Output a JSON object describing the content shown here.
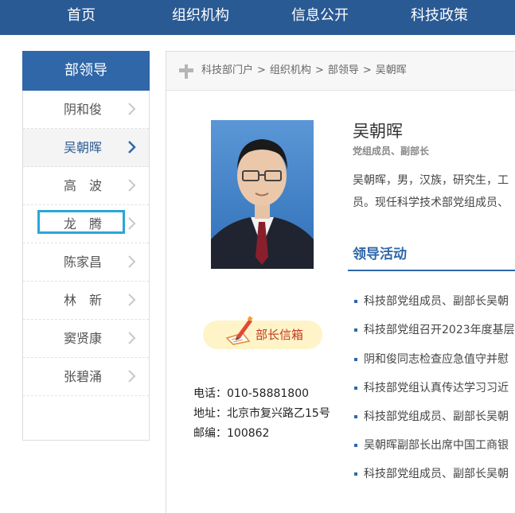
{
  "nav": {
    "items": [
      "首页",
      "组织机构",
      "信息公开",
      "科技政策"
    ]
  },
  "sidebar": {
    "title": "部领导",
    "items": [
      {
        "label": "阴和俊"
      },
      {
        "label": "吴朝晖"
      },
      {
        "label": "高　波"
      },
      {
        "label": "龙　腾"
      },
      {
        "label": "陈家昌"
      },
      {
        "label": "林　新"
      },
      {
        "label": "窦贤康"
      },
      {
        "label": "张碧涌"
      }
    ],
    "active_index": 1,
    "focused_index": 3
  },
  "breadcrumb": [
    "科技部门户",
    "组织机构",
    "部领导",
    "吴朝晖"
  ],
  "profile": {
    "name": "吴朝晖",
    "title": "党组成员、副部长",
    "bio_line1": "吴朝晖，男，汉族，研究生，工",
    "bio_line2": "员。现任科学技术部党组成员、"
  },
  "activities": {
    "heading": "领导活动",
    "items": [
      "科技部党组成员、副部长吴朝",
      "科技部党组召开2023年度基层",
      "阴和俊同志检查应急值守并慰",
      "科技部党组认真传达学习习近",
      "科技部党组成员、副部长吴朝",
      "吴朝晖副部长出席中国工商银",
      "科技部党组成员、副部长吴朝"
    ]
  },
  "mailbox": {
    "label": "部长信箱"
  },
  "contact": {
    "phone_label": "电话：",
    "phone": "010-58881800",
    "address_label": "地址：",
    "address": "北京市复兴路乙15号",
    "zip_label": "邮编：",
    "zip": "100862"
  },
  "colors": {
    "nav_bg": "#2a5a94",
    "accent": "#2f67a8",
    "focus": "#2aa7d8",
    "mail_bg": "#fff4c8",
    "mail_text": "#c23a1d"
  }
}
